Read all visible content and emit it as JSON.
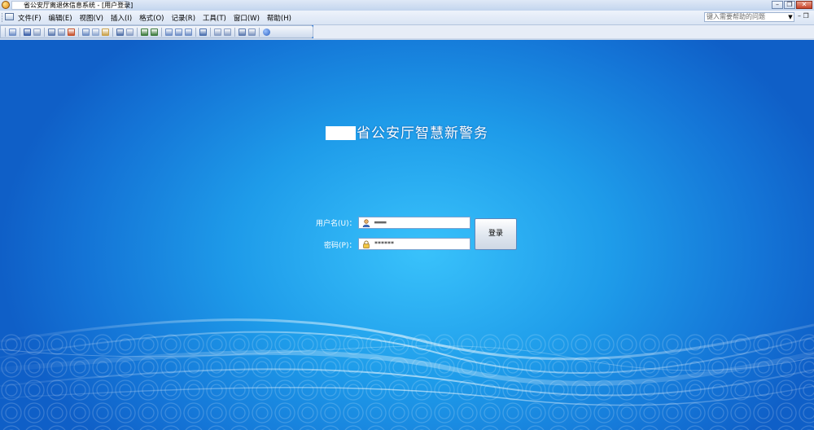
{
  "window": {
    "title": "省公安厅离退休信息系统 - [用户登录]",
    "title_redacted_prefix": "•—•"
  },
  "menu": {
    "items": [
      {
        "label": "文件(F)"
      },
      {
        "label": "编辑(E)"
      },
      {
        "label": "视图(V)"
      },
      {
        "label": "插入(I)"
      },
      {
        "label": "格式(O)"
      },
      {
        "label": "记录(R)"
      },
      {
        "label": "工具(T)"
      },
      {
        "label": "窗口(W)"
      },
      {
        "label": "帮助(H)"
      }
    ],
    "help_placeholder": "键入需要帮助的问题"
  },
  "toolbar": {
    "icons": [
      "design-view-icon",
      "save-icon",
      "file-search-icon",
      "print-icon",
      "print-preview-icon",
      "spelling-icon",
      "cut-icon",
      "copy-icon",
      "paste-icon",
      "undo-icon",
      "insert-hyperlink-icon",
      "sort-ascending-icon",
      "sort-descending-icon",
      "filter-by-selection-icon",
      "filter-by-form-icon",
      "apply-filter-icon",
      "find-icon",
      "new-record-icon",
      "delete-record-icon",
      "database-window-icon",
      "new-object-icon",
      "help-icon"
    ]
  },
  "login": {
    "headline": "省公安厅智慧新警务",
    "username_label": "用户名(U)：",
    "username_value": "═══",
    "password_label": "密码(P)：",
    "password_value": "******",
    "login_button": "登录"
  },
  "colors": {
    "background": "#1a8fe3",
    "title_bar": "#c3d5ee",
    "menu_bar": "#dfe8f5"
  }
}
